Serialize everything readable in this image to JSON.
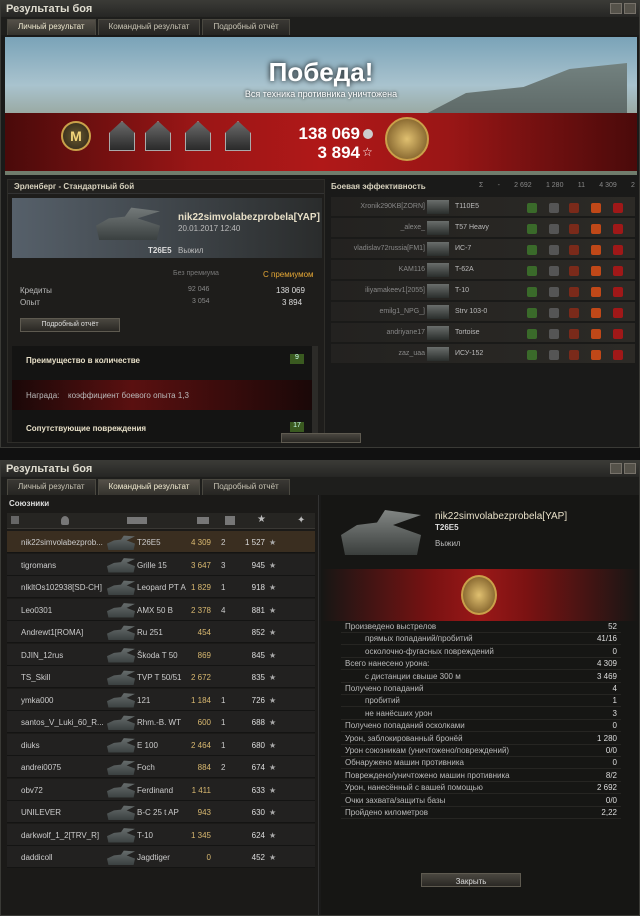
{
  "top": {
    "title": "Результаты боя",
    "tabs": [
      "Личный результат",
      "Командный результат",
      "Подробный отчёт"
    ],
    "victory": "Победа!",
    "victory_sub": "Вся техника противника уничтожена",
    "credits": "138 069",
    "exp": "3 894",
    "medal_letter": "M",
    "battle": "Эрленберг - Стандартный бой",
    "player": "nik22simvolabezprobela[YAP]",
    "date": "20.01.2017 12:40",
    "tank": "T26E5",
    "status": "Выжил",
    "no_prem": "Без премиума",
    "prem": "С премиумом",
    "credits_label": "Кредиты",
    "exp_label": "Опыт",
    "credits_base": "92 046",
    "credits_prem": "138 069",
    "exp_base": "3 054",
    "exp_prem": "3 894",
    "detail_btn": "Подробный отчёт",
    "adv": "Преимущество в количестве",
    "adv_val": "9",
    "reward": "Награда:",
    "reward_txt": "коэффициент боевого опыта 1,3",
    "assist": "Сопутствующие повреждения",
    "assist_val": "17",
    "eff_title": "Боевая эффективность",
    "eff_cols": [
      "Σ",
      "-",
      "2 692",
      "1 280",
      "11",
      "4 309",
      "2"
    ],
    "eff": [
      {
        "p": "Xronik290KB[ZORN]",
        "t": "T110E5"
      },
      {
        "p": "_alexe_",
        "t": "T57 Heavy"
      },
      {
        "p": "vladislav72russia[FM1]",
        "t": "ИС-7"
      },
      {
        "p": "KAM116",
        "t": "T-62A"
      },
      {
        "p": "iliyamakeev1[2055]",
        "t": "T-10"
      },
      {
        "p": "emilg1_NPG_]",
        "t": "Strv 103-0"
      },
      {
        "p": "andriyane17",
        "t": "Tortoise"
      },
      {
        "p": "zaz_uaa",
        "t": "ИСУ-152"
      }
    ]
  },
  "bottom": {
    "title": "Результаты боя",
    "tabs": [
      "Личный результат",
      "Командный результат",
      "Подробный отчёт"
    ],
    "allies": "Союзники",
    "rows": [
      {
        "p": "nik22simvolabezprob...",
        "t": "T26E5",
        "d": "4 309",
        "k": "2",
        "x": "1 527",
        "sel": true
      },
      {
        "p": "tigromans",
        "t": "Grille 15",
        "d": "3 647",
        "k": "3",
        "x": "945"
      },
      {
        "p": "nlkltOs102938[SD-CH]",
        "t": "Leopard PT A",
        "d": "1 829",
        "k": "1",
        "x": "918"
      },
      {
        "p": "Leo0301",
        "t": "AMX 50 B",
        "d": "2 378",
        "k": "4",
        "x": "881"
      },
      {
        "p": "Andrewt1[ROMA]",
        "t": "Ru 251",
        "d": "454",
        "k": "",
        "x": "852"
      },
      {
        "p": "DJIN_12rus",
        "t": "Škoda T 50",
        "d": "869",
        "k": "",
        "x": "845"
      },
      {
        "p": "TS_Skill",
        "t": "TVP T 50/51",
        "d": "2 672",
        "k": "",
        "x": "835"
      },
      {
        "p": "ymka000",
        "t": "121",
        "d": "1 184",
        "k": "1",
        "x": "726"
      },
      {
        "p": "santos_V_Luki_60_R...",
        "t": "Rhm.-B. WT",
        "d": "600",
        "k": "1",
        "x": "688"
      },
      {
        "p": "diuks",
        "t": "E 100",
        "d": "2 464",
        "k": "1",
        "x": "680"
      },
      {
        "p": "andrei0075",
        "t": "Foch",
        "d": "884",
        "k": "2",
        "x": "674"
      },
      {
        "p": "obv72",
        "t": "Ferdinand",
        "d": "1 411",
        "k": "",
        "x": "633"
      },
      {
        "p": "UNILEVER",
        "t": "B-C 25 t AP",
        "d": "943",
        "k": "",
        "x": "630"
      },
      {
        "p": "darkwolf_1_2[TRV_R]",
        "t": "T-10",
        "d": "1 345",
        "k": "",
        "x": "624"
      },
      {
        "p": "daddicoll",
        "t": "Jagdtiger",
        "d": "0",
        "k": "",
        "x": "452"
      }
    ],
    "detail_player": "nik22simvolabezprobela[YAP]",
    "detail_tank": "T26E5",
    "detail_status": "Выжил",
    "stats": [
      {
        "l": "Произведено выстрелов",
        "v": "52",
        "i": 0
      },
      {
        "l": "прямых попаданий/пробитий",
        "v": "41/16",
        "i": 1
      },
      {
        "l": "осколочно-фугасных повреждений",
        "v": "0",
        "i": 1
      },
      {
        "l": "Всего нанесено урона:",
        "v": "4 309",
        "i": 0
      },
      {
        "l": "с дистанции свыше 300 м",
        "v": "3 469",
        "i": 1
      },
      {
        "l": "Получено попаданий",
        "v": "4",
        "i": 0
      },
      {
        "l": "пробитий",
        "v": "1",
        "i": 1
      },
      {
        "l": "не нанёсших урон",
        "v": "3",
        "i": 1
      },
      {
        "l": "Получено попаданий осколками",
        "v": "0",
        "i": 0
      },
      {
        "l": "Урон, заблокированный бронёй",
        "v": "1 280",
        "i": 0
      },
      {
        "l": "Урон союзникам (уничтожено/повреждений)",
        "v": "0/0",
        "i": 0
      },
      {
        "l": "Обнаружено машин противника",
        "v": "0",
        "i": 0
      },
      {
        "l": "Повреждено/уничтожено машин противника",
        "v": "8/2",
        "i": 0
      },
      {
        "l": "Урон, нанесённый с вашей помощью",
        "v": "2 692",
        "i": 0
      },
      {
        "l": "Очки захвата/защиты базы",
        "v": "0/0",
        "i": 0
      },
      {
        "l": "Пройдено километров",
        "v": "2,22",
        "i": 0
      }
    ],
    "close": "Закрыть"
  }
}
